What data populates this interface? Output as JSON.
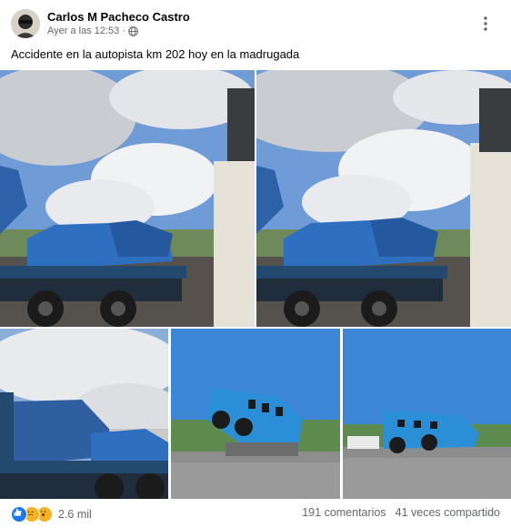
{
  "post": {
    "author": "Carlos M Pacheco Castro",
    "timestamp": "Ayer a las 12:53",
    "separator": "·",
    "audience_icon": "globe-icon",
    "caption": "Accidente en la autopista km 202 hoy en la madrugada"
  },
  "photos": [
    {
      "alt": "Camión azul accidentado sobre plataforma"
    },
    {
      "alt": "Camión azul accidentado sobre plataforma, otro ángulo"
    },
    {
      "alt": "Cabina destrozada sobre plataforma"
    },
    {
      "alt": "Ómnibus azul volcado sobre el muro de la autopista"
    },
    {
      "alt": "Ómnibus azul sobre el muro, vista lateral"
    }
  ],
  "footer": {
    "reaction_icons": [
      "like-icon",
      "sad-icon",
      "wow-icon"
    ],
    "reaction_count": "2.6 mil",
    "comments": "191 comentarios",
    "shares": "41 veces compartido"
  },
  "colors": {
    "like": "#1877f2",
    "reaction_yellow": "#f7b125",
    "secondary_text": "#65676b",
    "truck_blue": "#2f6fc0",
    "bus_blue": "#2a8fd6"
  }
}
